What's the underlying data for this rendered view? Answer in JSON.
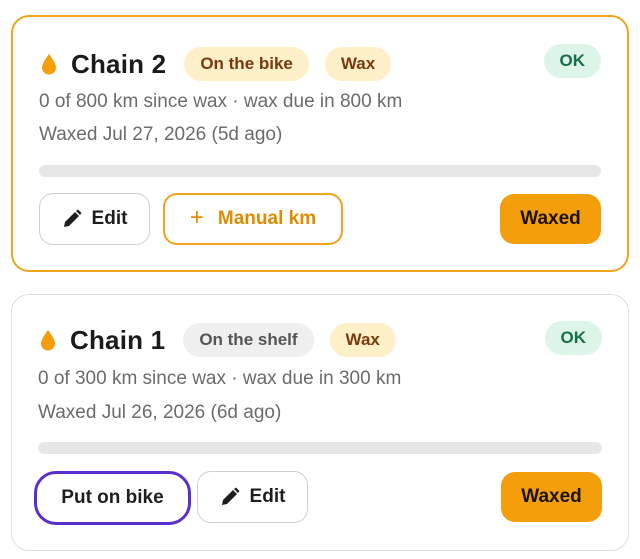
{
  "colors": {
    "accent": "#f59e0b",
    "accent_border": "#f0a41d",
    "ok_bg": "#dcf5e8",
    "ok_text": "#177048",
    "focus_ring": "#5a2fd0"
  },
  "cards": [
    {
      "name": "Chain 2",
      "icon": "drop-icon",
      "location_badge": "On the bike",
      "type_badge": "Wax",
      "status": "OK",
      "usage_line": "0 of 800 km since wax · wax due in 800 km",
      "waxed_line": "Waxed Jul 27, 2026 (5d ago)",
      "progress_fraction": 0,
      "buttons": {
        "edit": "Edit",
        "manual_km": "Manual km",
        "waxed": "Waxed"
      }
    },
    {
      "name": "Chain 1",
      "icon": "drop-icon",
      "location_badge": "On the shelf",
      "type_badge": "Wax",
      "status": "OK",
      "usage_line": "0 of 300 km since wax · wax due in 300 km",
      "waxed_line": "Waxed Jul 26, 2026 (6d ago)",
      "progress_fraction": 0,
      "buttons": {
        "put_on_bike": "Put on bike",
        "edit": "Edit",
        "waxed": "Waxed"
      }
    }
  ]
}
